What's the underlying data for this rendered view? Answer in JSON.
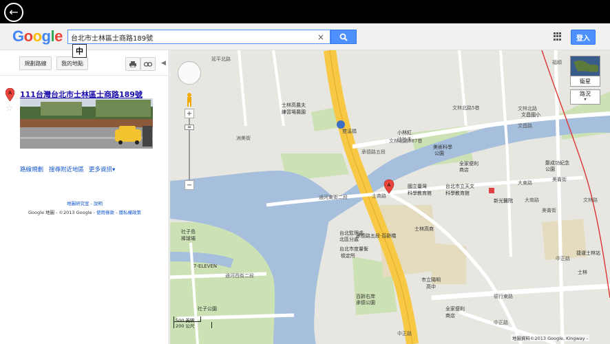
{
  "window": {
    "back_icon": "back-arrow-icon"
  },
  "header": {
    "logo": [
      {
        "ch": "G",
        "color": "#4285f4"
      },
      {
        "ch": "o",
        "color": "#ea4335"
      },
      {
        "ch": "o",
        "color": "#fbbc05"
      },
      {
        "ch": "g",
        "color": "#4285f4"
      },
      {
        "ch": "l",
        "color": "#34a853"
      },
      {
        "ch": "e",
        "color": "#ea4335"
      }
    ],
    "search_value": "台北市士林區士商路189號",
    "clear_label": "×",
    "ime_indicator": "中",
    "signin_label": "登入"
  },
  "panel": {
    "get_directions": "規劃路線",
    "my_places": "我的地點",
    "print_icon": "printer-icon",
    "link_icon": "link-icon",
    "result": {
      "title": "111台灣台北市士林區士商路189號",
      "marker_letter": "A",
      "star": "☆"
    },
    "actions": {
      "directions": "路線規劃",
      "search_nearby": "搜尋附近地區",
      "more_info": "更多資訊▾"
    },
    "footer": {
      "labs": "地圖研究室 - 說明",
      "copyright_prefix": "Google 地圖 - ©2013 Google - ",
      "terms": "使用條款",
      "privacy": "隱私權政策",
      "sep": " - "
    }
  },
  "map": {
    "satellite_label": "衛星",
    "traffic_label": "路況",
    "traffic_arrow": "▾",
    "marker_letter": "A",
    "scale": {
      "imperial": "500 英呎",
      "metric": "200 公尺"
    },
    "copyright": "地圖資料©2013 Google, Kingway -",
    "labels": [
      {
        "t": "士林高農夫",
        "c": "#333"
      },
      {
        "t": "練習場農園",
        "c": "#333"
      },
      {
        "t": "文林北路5巷",
        "c": "#555"
      },
      {
        "t": "文林北路587巷",
        "c": "#555"
      },
      {
        "t": "小林紅",
        "c": "#333"
      },
      {
        "t": "油抄手",
        "c": "#333"
      },
      {
        "t": "美術科學",
        "c": "#333"
      },
      {
        "t": "公園",
        "c": "#333"
      },
      {
        "t": "全家便利",
        "c": "#333"
      },
      {
        "t": "商店",
        "c": "#333"
      },
      {
        "t": "國立臺灣",
        "c": "#333"
      },
      {
        "t": "科學教育館",
        "c": "#333"
      },
      {
        "t": "台北市立天文",
        "c": "#333"
      },
      {
        "t": "科學教育館",
        "c": "#333"
      },
      {
        "t": "新光醫院",
        "c": "#333"
      },
      {
        "t": "士商路",
        "c": "#555"
      },
      {
        "t": "士林高商",
        "c": "#333"
      },
      {
        "t": "台北監理處",
        "c": "#333"
      },
      {
        "t": "北區分處",
        "c": "#333"
      },
      {
        "t": "台北市度量衡",
        "c": "#333"
      },
      {
        "t": "檢定所",
        "c": "#333"
      },
      {
        "t": "社子島",
        "c": "#333"
      },
      {
        "t": "棒球場",
        "c": "#333"
      },
      {
        "t": "7-ELEVEN",
        "c": "#333"
      },
      {
        "t": "社子公園",
        "c": "#333"
      },
      {
        "t": "百齡右岸",
        "c": "#333"
      },
      {
        "t": "承德公園",
        "c": "#333"
      },
      {
        "t": "市立陽明",
        "c": "#333"
      },
      {
        "t": "高中",
        "c": "#333"
      },
      {
        "t": "全家便利",
        "c": "#333"
      },
      {
        "t": "商店",
        "c": "#333"
      },
      {
        "t": "中正路",
        "c": "#555"
      },
      {
        "t": "文昌國小",
        "c": "#333"
      },
      {
        "t": "文昌路",
        "c": "#555"
      },
      {
        "t": "鄭成功紀念",
        "c": "#333"
      },
      {
        "t": "公園",
        "c": "#333"
      },
      {
        "t": "捷運士林站",
        "c": "#333"
      },
      {
        "t": "士林",
        "c": "#333"
      },
      {
        "t": "福順",
        "c": "#555"
      },
      {
        "t": "承德路五段",
        "c": "#555"
      },
      {
        "t": "洲美街",
        "c": "#555"
      },
      {
        "t": "通河東街二段",
        "c": "#555"
      },
      {
        "t": "通河西街二段",
        "c": "#555"
      },
      {
        "t": "延平北路",
        "c": "#555"
      },
      {
        "t": "文林北路",
        "c": "#555"
      },
      {
        "t": "大東路",
        "c": "#555"
      },
      {
        "t": "大南路",
        "c": "#555"
      },
      {
        "t": "美崙街",
        "c": "#555"
      },
      {
        "t": "文林路",
        "c": "#555"
      },
      {
        "t": "雙溪橋",
        "c": "#555"
      },
      {
        "t": "承德路五段·百齡橋",
        "c": "#333"
      },
      {
        "t": "中正路",
        "c": "#555"
      },
      {
        "t": "德行東路",
        "c": "#555"
      },
      {
        "t": "美崙街",
        "c": "#555"
      },
      {
        "t": "中正路",
        "c": "#555"
      }
    ]
  }
}
